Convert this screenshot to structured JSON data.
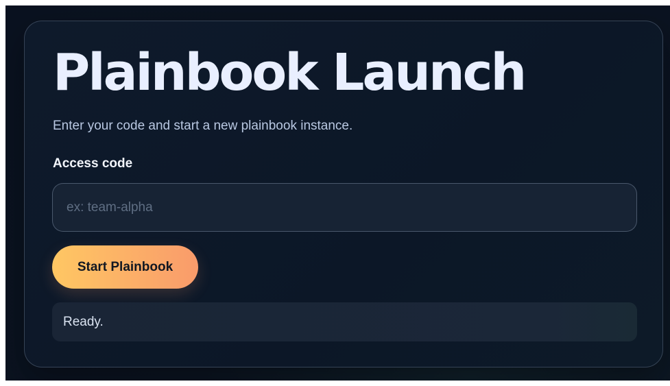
{
  "app": {
    "title": "Plainbook Launch",
    "subtitle": "Enter your code and start a new plainbook instance."
  },
  "form": {
    "access_code": {
      "label": "Access code",
      "value": "",
      "placeholder": "ex: team-alpha"
    },
    "start_button_label": "Start Plainbook"
  },
  "status": {
    "text": "Ready."
  },
  "colors": {
    "background": "#0a1220",
    "card": "#0e1a2b",
    "title": "#e9efff",
    "button_gradient_start": "#ffc763",
    "button_gradient_end": "#f99b6b",
    "status_panel": "#1a2536"
  }
}
